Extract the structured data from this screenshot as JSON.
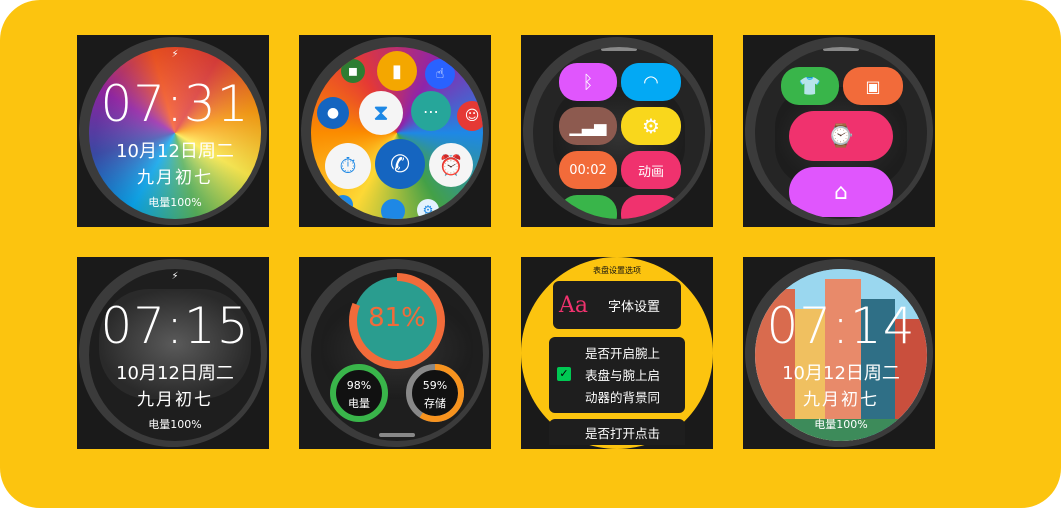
{
  "tiles": {
    "clock1": {
      "time": "07:31",
      "date": "10月12日周二",
      "lunar": "九月初七",
      "battery": "电量100%"
    },
    "clock2": {
      "time": "07:15",
      "date": "10月12日周二",
      "lunar": "九月初七",
      "battery": "电量100%"
    },
    "clock3": {
      "time": "07:14",
      "date": "10月12日周二",
      "lunar": "九月初七",
      "battery": "电量100%"
    },
    "controls": {
      "timer": "00:02",
      "animation": "动画"
    },
    "stats": {
      "main_percent": "81%",
      "battery_pct": "98%",
      "battery_label": "电量",
      "storage_pct": "59%",
      "storage_label": "存储"
    },
    "settings": {
      "header": "表盘设置选项",
      "font_item": "字体设置",
      "toggle_text_line1": "是否开启腕上",
      "toggle_text_line2": "表盘与腕上启",
      "toggle_text_line3": "动器的背景同",
      "cut_line": "是否打开点击"
    }
  },
  "icons": [
    "flashlight-icon",
    "touch-icon",
    "person-icon",
    "hourglass-icon",
    "chat-icon",
    "emoji-icon",
    "stopwatch-icon",
    "phone-icon",
    "alarm-icon",
    "bluetooth-icon",
    "wifi-icon",
    "signal-icon",
    "gear-icon",
    "shirt-icon",
    "image-icon",
    "watch-icon",
    "home-icon",
    "checkbox-icon",
    "font-icon"
  ],
  "colors": {
    "background": "#fcc40f",
    "tile": "#1a1a1a",
    "orange": "#f26b3a",
    "green": "#39b54a",
    "magenta": "#e040d0",
    "blue": "#2979ff"
  }
}
